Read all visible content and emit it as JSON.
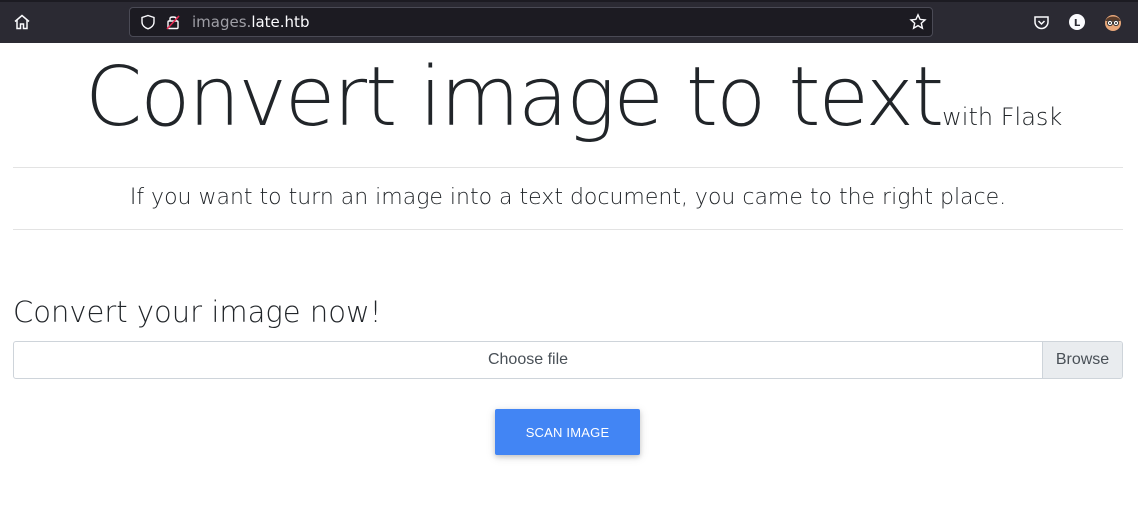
{
  "browser": {
    "url_subdomain": "images.",
    "url_host": "late.htb"
  },
  "page": {
    "title": "Convert image to text",
    "title_small": "with Flask",
    "lead": "If you want to turn an image into a text document, you came to the right place.",
    "section_title": "Convert your image now!",
    "file_input": {
      "placeholder": "Choose file",
      "browse_label": "Browse"
    },
    "scan_button_label": "SCAN IMAGE"
  },
  "colors": {
    "primary_button": "#4285f4",
    "browser_chrome": "#2b2a33"
  }
}
